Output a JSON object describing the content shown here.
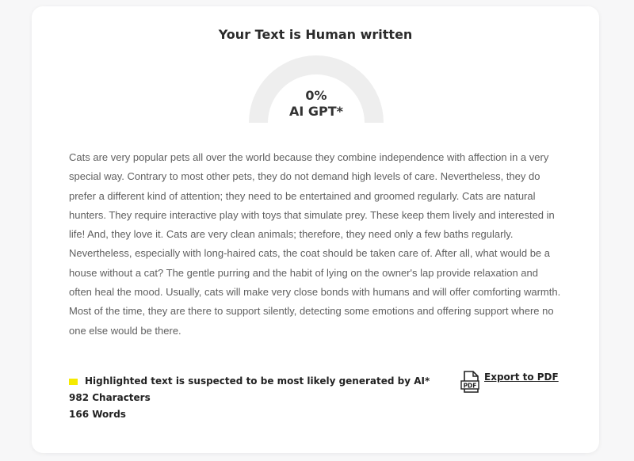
{
  "result": {
    "title": "Your Text is Human written"
  },
  "gauge": {
    "percent_text": "0%",
    "label": "AI GPT*",
    "value": 0,
    "track_color": "#eeeeee"
  },
  "analyzed_text": "Cats are very popular pets all over the world because they combine independence with affection in a very special way. Contrary to most other pets, they do not demand high levels of care. Nevertheless, they do prefer a different kind of attention; they need to be entertained and groomed regularly. Cats are natural hunters. They require interactive play with toys that simulate prey. These keep them lively and interested in life! And, they love it. Cats are very clean animals; therefore, they need only a few baths regularly. Nevertheless, especially with long-haired cats, the coat should be taken care of. After all, what would be a house without a cat? The gentle purring and the habit of lying on the owner's lap provide relaxation and often heal the mood. Usually, cats will make very close bonds with humans and will offer comforting warmth. Most of the time, they are there to support silently, detecting some emotions and offering support where no one else would be there.",
  "legend": {
    "highlight_note": "Highlighted text is suspected to be most likely generated by AI*",
    "highlight_color": "#f5ea00",
    "characters": "982 Characters",
    "words": "166 Words"
  },
  "export": {
    "label": "Export to PDF",
    "icon": "pdf-file-icon"
  }
}
